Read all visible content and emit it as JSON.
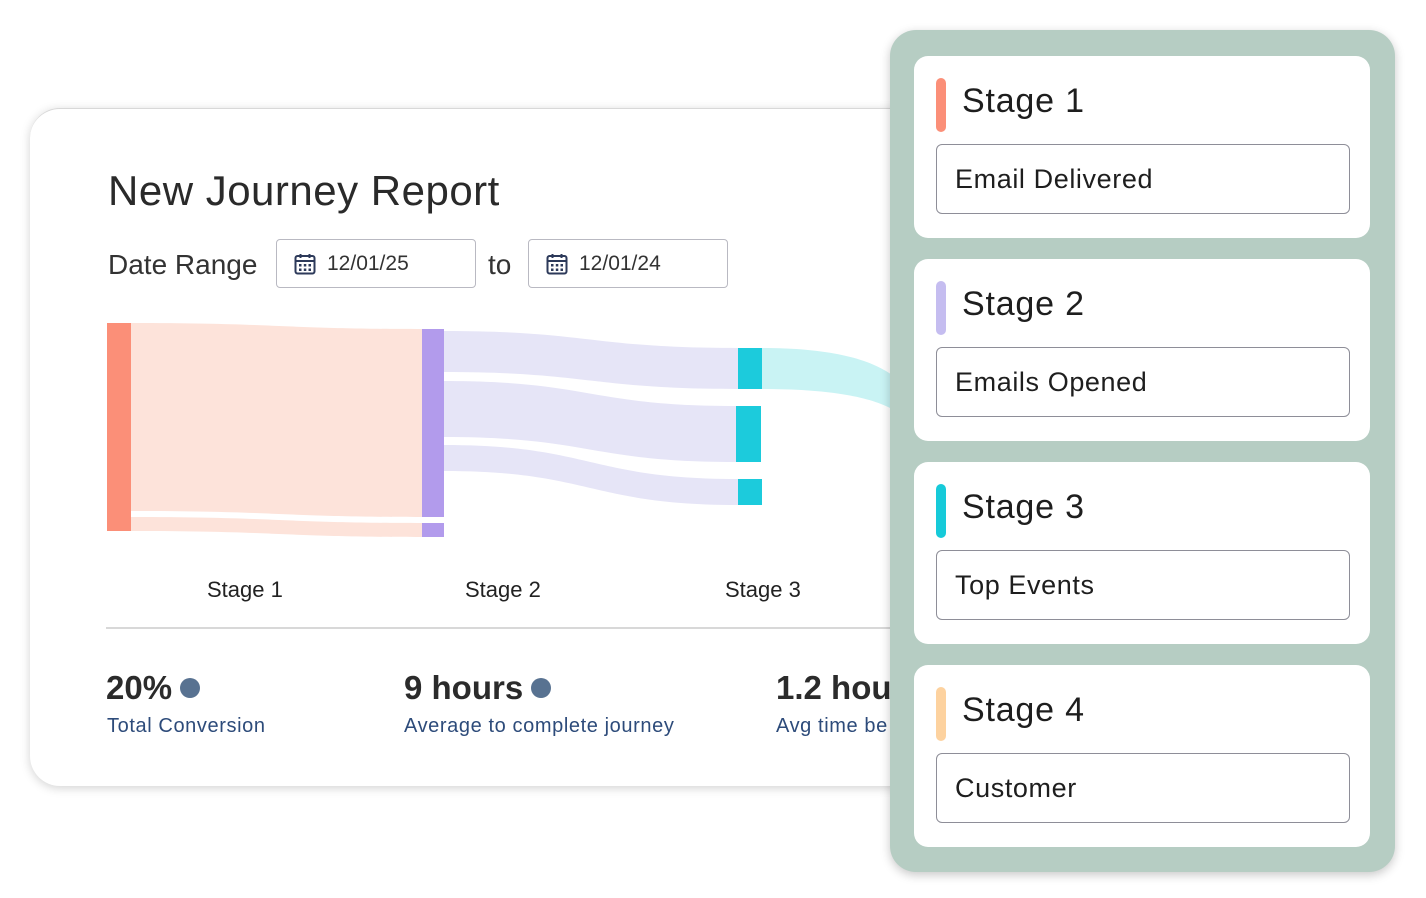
{
  "report": {
    "title": "New Journey Report",
    "date_range_label": "Date Range",
    "date_from": "12/01/25",
    "to_label": "to",
    "date_to": "12/01/24"
  },
  "chart_data": {
    "type": "sankey",
    "stages": [
      "Stage 1",
      "Stage 2",
      "Stage 3"
    ],
    "colors": {
      "stage1": "#fb8f78",
      "stage2": "#b29bec",
      "stage3": "#1ccbdc",
      "stage1_flow": "#fde3da",
      "stage2_flow": "#e6e5f7",
      "stage3_flow": "#c9f3f4"
    }
  },
  "metrics": [
    {
      "value": "20%",
      "caption": "Total Conversion"
    },
    {
      "value": "9 hours",
      "caption": "Average to complete journey"
    },
    {
      "value": "1.2 hou",
      "caption": "Avg time be"
    }
  ],
  "stages_panel": [
    {
      "title": "Stage 1",
      "field": "Email Delivered",
      "color": "#fb8f78"
    },
    {
      "title": "Stage 2",
      "field": "Emails Opened",
      "color": "#c5bdf0"
    },
    {
      "title": "Stage 3",
      "field": "Top Events",
      "color": "#16cad9"
    },
    {
      "title": "Stage 4",
      "field": "Customer",
      "color": "#fdd29f"
    }
  ]
}
